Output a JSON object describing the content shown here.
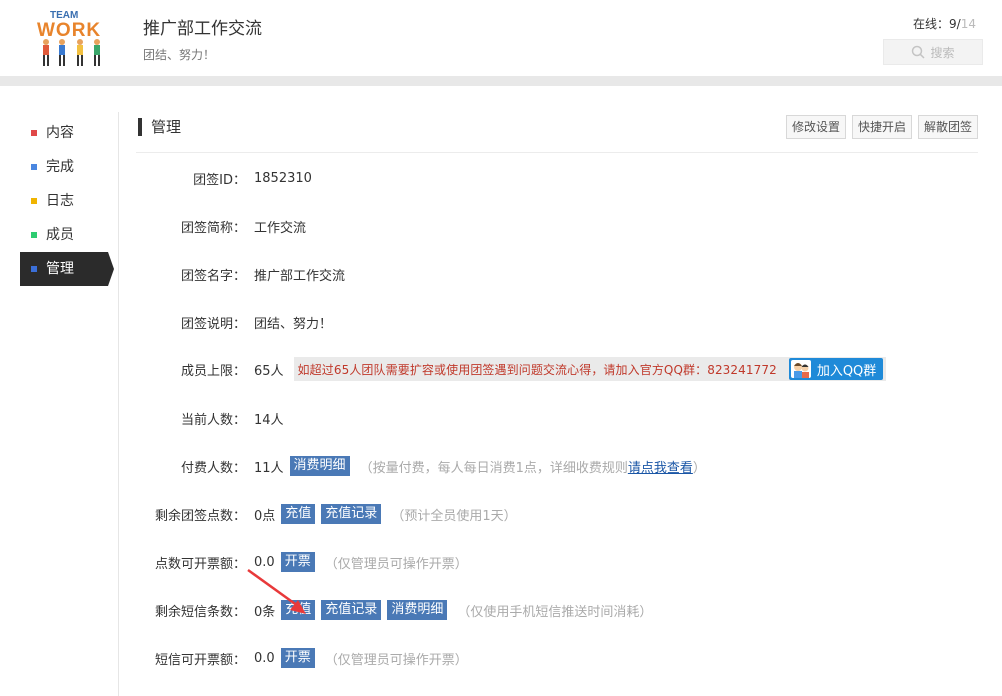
{
  "header": {
    "logo_text_top": "TEAM",
    "logo_text_main": "WORK",
    "team_name": "推广部工作交流",
    "slogan": "团结、努力！",
    "online_label": "在线：",
    "online_count": "9/",
    "online_total": "14",
    "search_placeholder": "搜索"
  },
  "sidebar": {
    "items": [
      {
        "label": "内容",
        "color": "#e04848"
      },
      {
        "label": "完成",
        "color": "#4a86e0"
      },
      {
        "label": "日志",
        "color": "#f0b400"
      },
      {
        "label": "成员",
        "color": "#2ecc71"
      },
      {
        "label": "管理",
        "color": "#3b6fd8"
      }
    ],
    "active_index": 4
  },
  "main": {
    "title": "管理",
    "actions": [
      "修改设置",
      "快捷开启",
      "解散团签"
    ],
    "rows": {
      "id": {
        "label": "团签ID：",
        "value": "1852310"
      },
      "short_name": {
        "label": "团签简称：",
        "value": "工作交流"
      },
      "full_name": {
        "label": "团签名字：",
        "value": "推广部工作交流"
      },
      "desc": {
        "label": "团签说明：",
        "value": "团结、努力！"
      },
      "limit": {
        "label": "成员上限：",
        "value": "65人",
        "notice": "如超过65人团队需要扩容或使用团签遇到问题交流心得，请加入官方QQ群：823241772",
        "qq_button": "加入QQ群"
      },
      "current": {
        "label": "当前人数：",
        "value": "14人"
      },
      "paid": {
        "label": "付费人数：",
        "value": "11人",
        "button": "消费明细",
        "note_prefix": "（按量付费，每人每日消费1点，详细收费规则",
        "note_link": "请点我查看",
        "note_suffix": "）"
      },
      "points": {
        "label": "剩余团签点数：",
        "value": "0点",
        "btn_recharge": "充值",
        "btn_record": "充值记录",
        "note": "（预计全员使用1天）"
      },
      "points_invoice": {
        "label": "点数可开票额：",
        "value": "0.0",
        "button": "开票",
        "note": "（仅管理员可操作开票）"
      },
      "sms": {
        "label": "剩余短信条数：",
        "value": "0条",
        "btn_recharge": "充值",
        "btn_record": "充值记录",
        "btn_detail": "消费明细",
        "note": "（仅使用手机短信推送时间消耗）"
      },
      "sms_invoice": {
        "label": "短信可开票额：",
        "value": "0.0",
        "button": "开票",
        "note": "（仅管理员可操作开票）"
      }
    }
  },
  "colors": {
    "accent_blue": "#4a79b6",
    "qq_blue": "#1f8ad8",
    "notice_red": "#c0392b",
    "arrow_red": "#e8393a"
  }
}
